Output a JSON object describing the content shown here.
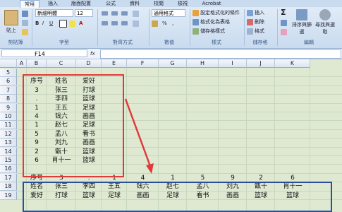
{
  "ribbon": {
    "tabs": [
      "常用",
      "插入",
      "版面配置",
      "公式",
      "資料",
      "校閱",
      "檢視",
      "Acrobat"
    ],
    "clipboard": {
      "paste": "貼上",
      "label": "剪貼簿"
    },
    "font": {
      "name": "新細明體",
      "size": "12",
      "label": "字型"
    },
    "align": {
      "label": "對齊方式"
    },
    "number": {
      "format": "通用格式",
      "label": "數值"
    },
    "styles": {
      "cond": "設定格式化的條件",
      "table": "格式化為表格",
      "cell": "儲存格樣式",
      "label": "樣式"
    },
    "cells": {
      "insert": "插入",
      "delete": "刪除",
      "format": "格式",
      "label": "儲存格"
    },
    "editing": {
      "sort": "排序與篩選",
      "find": "尋找與選取",
      "label": "編輯"
    }
  },
  "formula_bar": {
    "cell_ref": "F14",
    "fx": "fx"
  },
  "columns": [
    "A",
    "B",
    "C",
    "D",
    "E",
    "F",
    "G",
    "H",
    "I",
    "J",
    "K"
  ],
  "rows": [
    "5",
    "6",
    "7",
    "8",
    "9",
    "10",
    "11",
    "12",
    "13",
    "14",
    "15",
    "16",
    "17",
    "18",
    "19"
  ],
  "source_table": [
    [
      "序号",
      "姓名",
      "爱好"
    ],
    [
      "3",
      "张三",
      "打球"
    ],
    [
      ".",
      "李四",
      "篮球"
    ],
    [
      "1",
      "王五",
      "足球"
    ],
    [
      "4",
      "钱六",
      "画画"
    ],
    [
      "1",
      "赵七",
      "足球"
    ],
    [
      "5",
      "孟八",
      "看书"
    ],
    [
      "9",
      "刘九",
      "画画"
    ],
    [
      "2",
      "甑十",
      "篮球"
    ],
    [
      "6",
      "肖十一",
      "篮球"
    ]
  ],
  "transposed_table": [
    [
      "序号",
      "3",
      ".",
      "1",
      "4",
      "1",
      "5",
      "9",
      "2",
      "6"
    ],
    [
      "姓名",
      "张三",
      "李四",
      "王五",
      "钱六",
      "赵七",
      "孟八",
      "刘九",
      "甑十",
      "肖十一"
    ],
    [
      "爱好",
      "打球",
      "篮球",
      "足球",
      "画画",
      "足球",
      "看书",
      "画画",
      "篮球",
      "篮球"
    ]
  ],
  "colors": {
    "source_border": "#e03a3a",
    "arrow": "#e03a3a",
    "target_border": "#2a4e9a"
  }
}
